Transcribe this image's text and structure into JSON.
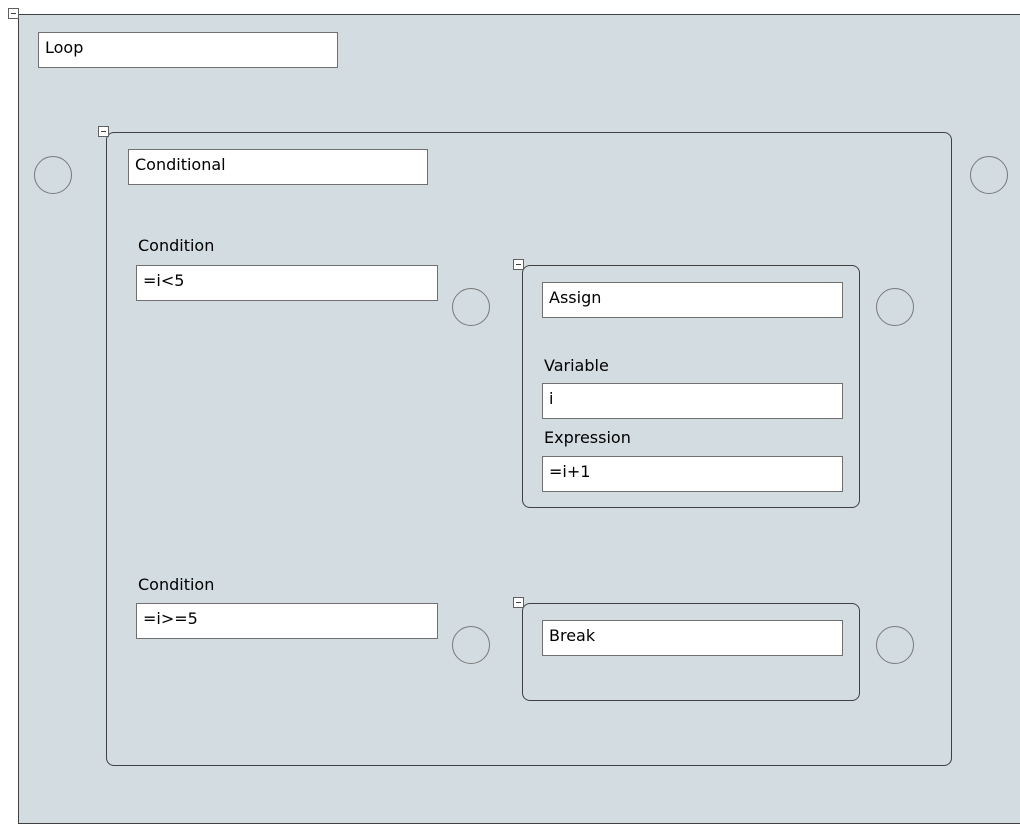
{
  "loop": {
    "title": "Loop"
  },
  "conditional": {
    "title": "Conditional",
    "branches": [
      {
        "condition_label": "Condition",
        "condition_value": "=i<5"
      },
      {
        "condition_label": "Condition",
        "condition_value": "=i>=5"
      }
    ]
  },
  "assign": {
    "title": "Assign",
    "variable_label": "Variable",
    "variable_value": "i",
    "expression_label": "Expression",
    "expression_value": "=i+1"
  },
  "break_block": {
    "title": "Break"
  },
  "colors": {
    "block_fill": "#d2dce1",
    "block_border": "#404040",
    "field_fill": "#ffffff"
  }
}
